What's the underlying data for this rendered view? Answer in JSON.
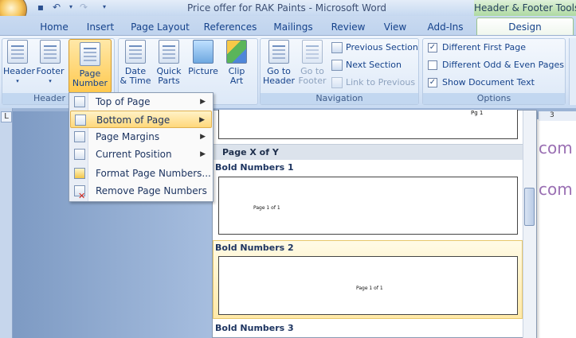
{
  "window": {
    "title": "Price offer for RAK Paints - Microsoft Word",
    "context_title": "Header & Footer Tools"
  },
  "tabs": [
    "Home",
    "Insert",
    "Page Layout",
    "References",
    "Mailings",
    "Review",
    "View",
    "Add-Ins"
  ],
  "active_tab": "Design",
  "ribbon": {
    "header_footer_group": {
      "label": "Header & F",
      "header": "Header",
      "footer": "Footer",
      "page_number_line1": "Page",
      "page_number_line2": "Number"
    },
    "insert_group": {
      "date_time_line1": "Date",
      "date_time_line2": "& Time",
      "quick_parts_line1": "Quick",
      "quick_parts_line2": "Parts",
      "picture": "Picture",
      "clip_art_line1": "Clip",
      "clip_art_line2": "Art"
    },
    "navigation_group": {
      "label": "Navigation",
      "go_to_header_line1": "Go to",
      "go_to_header_line2": "Header",
      "go_to_footer_line1": "Go to",
      "go_to_footer_line2": "Footer",
      "previous_section": "Previous Section",
      "next_section": "Next Section",
      "link_to_previous": "Link to Previous"
    },
    "options_group": {
      "label": "Options",
      "different_first_page": "Different First Page",
      "different_odd_even": "Different Odd & Even Pages",
      "show_document_text": "Show Document Text"
    }
  },
  "menu": {
    "items": [
      {
        "label": "Top of Page",
        "has_submenu": true
      },
      {
        "label": "Bottom of Page",
        "has_submenu": true
      },
      {
        "label": "Page Margins",
        "has_submenu": true
      },
      {
        "label": "Current Position",
        "has_submenu": true
      },
      {
        "label": "Format Page Numbers..."
      },
      {
        "label": "Remove Page Numbers"
      }
    ]
  },
  "gallery": {
    "top_preview_text": "Pg 1",
    "section_header": "Page X of Y",
    "items": [
      {
        "label": "Bold Numbers 1",
        "preview": "Page 1 of 1"
      },
      {
        "label": "Bold Numbers 2",
        "preview": "Page 1 of 1"
      },
      {
        "label": "Bold Numbers 3"
      }
    ]
  },
  "document": {
    "text1": "com",
    "text2": "com",
    "ruler_tick": "3"
  },
  "colors": {
    "accent": "#ffd87a",
    "doc_text": "#9a6fb3",
    "ribbon": "#dbe7f7"
  }
}
